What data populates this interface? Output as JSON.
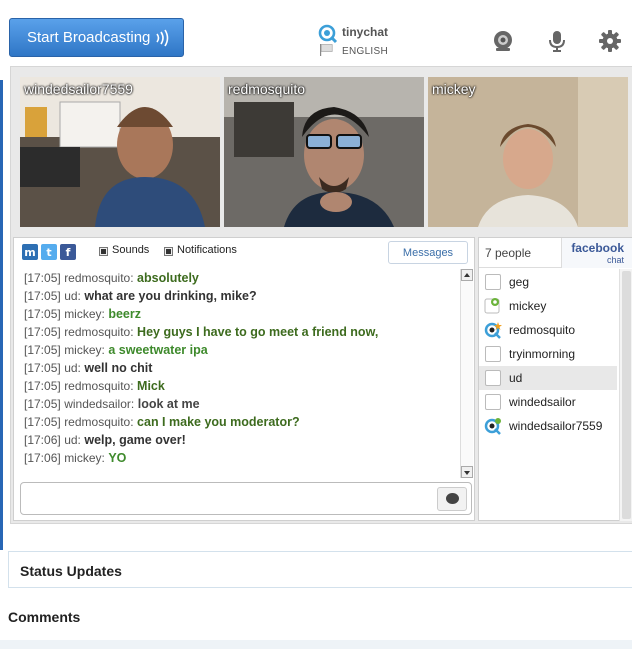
{
  "header": {
    "broadcast_button": "Start Broadcasting",
    "brand": "tinychat",
    "language": "ENGLISH",
    "icons": [
      "webcam-icon",
      "microphone-icon",
      "gear-icon"
    ]
  },
  "videos": [
    {
      "name": "windedsailor7559"
    },
    {
      "name": "redmosquito"
    },
    {
      "name": "mickey"
    }
  ],
  "chat": {
    "share_icons": [
      "myspace-icon",
      "twitter-icon",
      "facebook-icon"
    ],
    "sounds_label": "Sounds",
    "notifications_label": "Notifications",
    "messages_tab": "Messages",
    "input_placeholder": "",
    "messages": [
      {
        "time": "[17:05]",
        "nick": "redmosquito:",
        "text": "absolutely",
        "color": "#3d6b1e"
      },
      {
        "time": "[17:05]",
        "nick": "ud:",
        "text": "what are you drinking, mike?",
        "color": "#333333"
      },
      {
        "time": "[17:05]",
        "nick": "mickey:",
        "text": "beerz",
        "color": "#3e8a2c"
      },
      {
        "time": "[17:05]",
        "nick": "redmosquito:",
        "text": "Hey guys I have to go meet a friend now,",
        "color": "#3d6b1e"
      },
      {
        "time": "[17:05]",
        "nick": "mickey:",
        "text": "a sweetwater ipa",
        "color": "#3e8a2c"
      },
      {
        "time": "[17:05]",
        "nick": "ud:",
        "text": "well no chit",
        "color": "#333333"
      },
      {
        "time": "[17:05]",
        "nick": "redmosquito:",
        "text": "Mick",
        "color": "#3d6b1e"
      },
      {
        "time": "[17:05]",
        "nick": "windedsailor:",
        "text": "look at me",
        "color": "#444444"
      },
      {
        "time": "[17:05]",
        "nick": "redmosquito:",
        "text": "can I make you moderator?",
        "color": "#3d6b1e"
      },
      {
        "time": "[17:06]",
        "nick": "ud:",
        "text": "welp, game over!",
        "color": "#333333"
      },
      {
        "time": "[17:06]",
        "nick": "mickey:",
        "text": "YO",
        "color": "#3e8a2c"
      }
    ]
  },
  "people": {
    "count_label": "7 people",
    "facebook_line1": "facebook",
    "facebook_line2": "chat",
    "list": [
      {
        "name": "geg",
        "icon": "none",
        "highlight": false
      },
      {
        "name": "mickey",
        "icon": "broadcasting-icon",
        "highlight": false
      },
      {
        "name": "redmosquito",
        "icon": "moderator-camera-icon",
        "highlight": false
      },
      {
        "name": "tryinmorning",
        "icon": "none",
        "highlight": false
      },
      {
        "name": "ud",
        "icon": "none",
        "highlight": true
      },
      {
        "name": "windedsailor",
        "icon": "none",
        "highlight": false
      },
      {
        "name": "windedsailor7559",
        "icon": "camera-icon",
        "highlight": false
      }
    ]
  },
  "sections": {
    "status_updates": "Status Updates",
    "comments": "Comments"
  }
}
